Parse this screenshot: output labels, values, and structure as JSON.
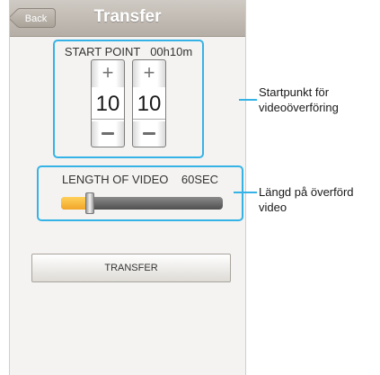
{
  "nav": {
    "back_label": "Back",
    "title": "Transfer"
  },
  "start_point": {
    "label": "START POINT",
    "time": "00h10m",
    "drums": [
      {
        "up_symbol": "+",
        "value": "10"
      },
      {
        "up_symbol": "+",
        "value": "10"
      }
    ]
  },
  "length": {
    "label": "LENGTH OF VIDEO",
    "value_text": "60SEC",
    "slider_fraction": 0.18
  },
  "transfer_button": {
    "label": "TRANSFER"
  },
  "callouts": {
    "start_point": "Startpunkt för videoöverföring",
    "length": "Längd på överförd video"
  },
  "colors": {
    "highlight": "#35b3e6",
    "slider_fill": "#f2a52a"
  }
}
